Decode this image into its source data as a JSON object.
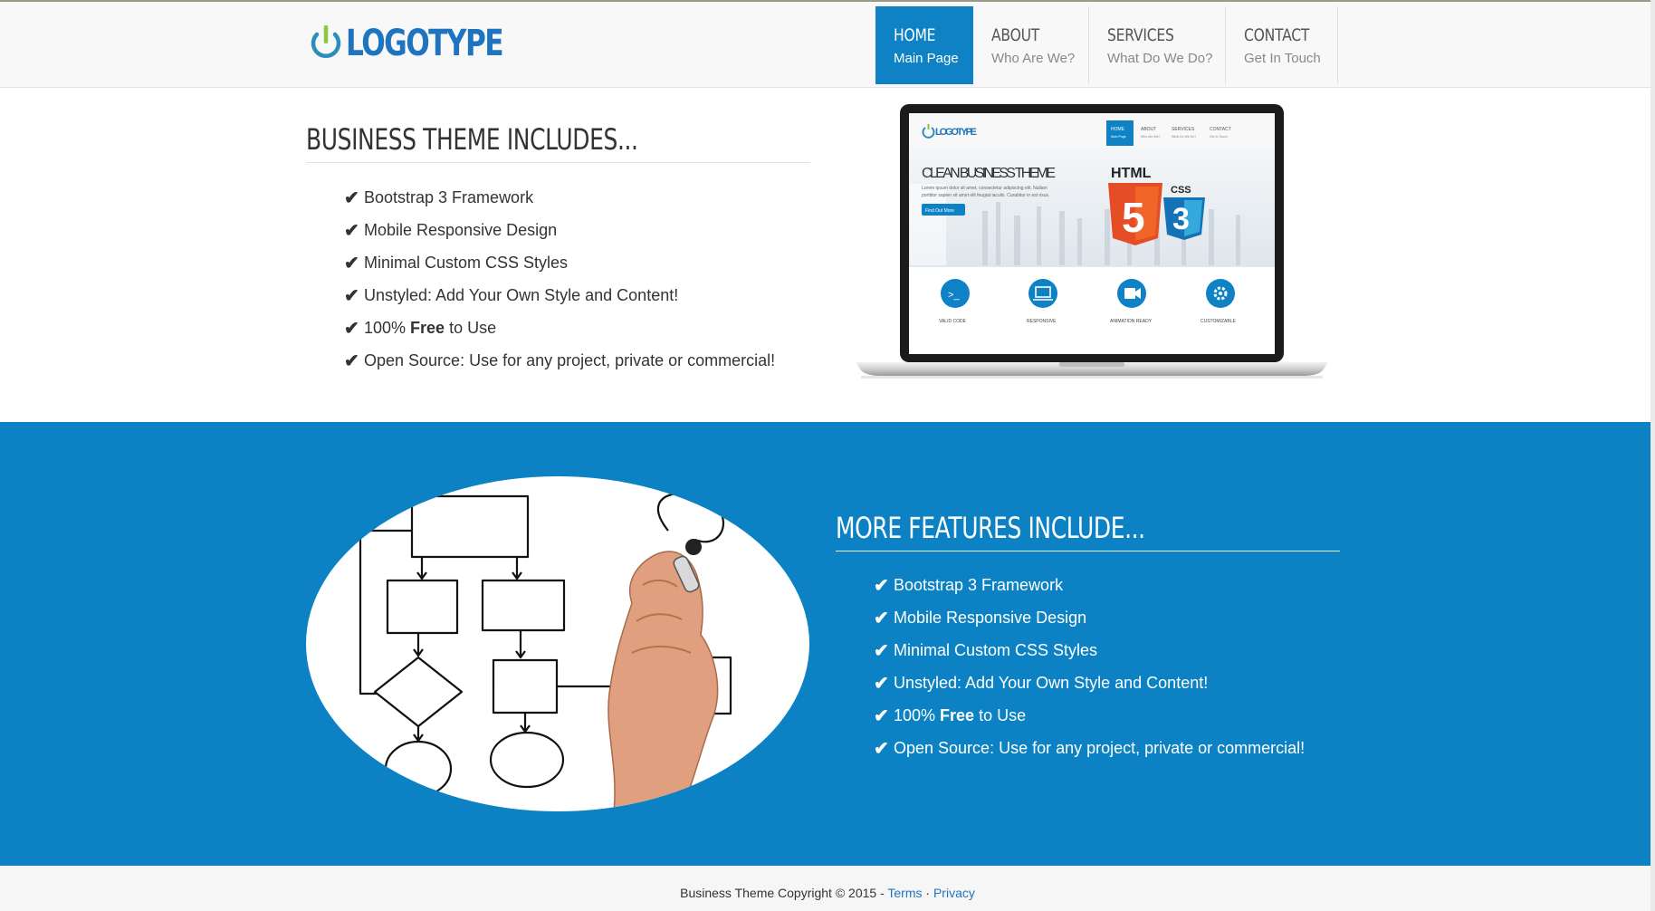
{
  "brand": {
    "logo_text": "LOGOTYPE",
    "accent": "#1f74c0",
    "nav_active_bg": "#0f82c6",
    "section_blue": "#0c82c4"
  },
  "nav": {
    "items": [
      {
        "title": "HOME",
        "subtitle": "Main Page"
      },
      {
        "title": "ABOUT",
        "subtitle": "Who Are We?"
      },
      {
        "title": "SERVICES",
        "subtitle": "What Do We Do?"
      },
      {
        "title": "CONTACT",
        "subtitle": "Get In Touch"
      }
    ]
  },
  "section1": {
    "title": "BUSINESS THEME INCLUDES...",
    "features": [
      {
        "text": "Bootstrap 3 Framework"
      },
      {
        "text": "Mobile Responsive Design"
      },
      {
        "text": "Minimal Custom CSS Styles"
      },
      {
        "text": "Unstyled: Add Your Own Style and Content!"
      },
      {
        "pre": "100% ",
        "bold": "Free",
        "post": " to Use"
      },
      {
        "text": "Open Source: Use for any project, private or commercial!"
      }
    ],
    "check_icon": "checkmark-icon"
  },
  "laptop_screen": {
    "logo": "LOGOTYPE",
    "nav": [
      "HOME",
      "ABOUT",
      "SERVICES",
      "CONTACT"
    ],
    "nav_sub": [
      "Main Page",
      "Who Are We?",
      "What Do We Do?",
      "Get In Touch"
    ],
    "hero_title": "CLEAN BUSINESS THEME",
    "hero_text_1": "Lorem ipsum dolor sit amet, consectetur adipiscing elit. Nullam",
    "hero_text_2": "porttitor sapien sit amet elit feugiat iaculis. Curabitur in est risus.",
    "hero_button": "Find Out More",
    "html_badge": "HTML",
    "html_num": "5",
    "css_badge": "CSS",
    "css_num": "3",
    "features": [
      "VALID CODE",
      "RESPONSIVE",
      "ANIMATION READY",
      "CUSTOMIZABLE"
    ]
  },
  "section2": {
    "title": "MORE FEATURES INCLUDE...",
    "features": [
      {
        "text": "Bootstrap 3 Framework"
      },
      {
        "text": "Mobile Responsive Design"
      },
      {
        "text": "Minimal Custom CSS Styles"
      },
      {
        "text": "Unstyled: Add Your Own Style and Content!"
      },
      {
        "pre": "100% ",
        "bold": "Free",
        "post": " to Use"
      },
      {
        "text": "Open Source: Use for any project, private or commercial!"
      }
    ]
  },
  "footer": {
    "copyright": "Business Theme Copyright © 2015 - ",
    "terms": "Terms",
    "separator": " · ",
    "privacy": "Privacy"
  }
}
